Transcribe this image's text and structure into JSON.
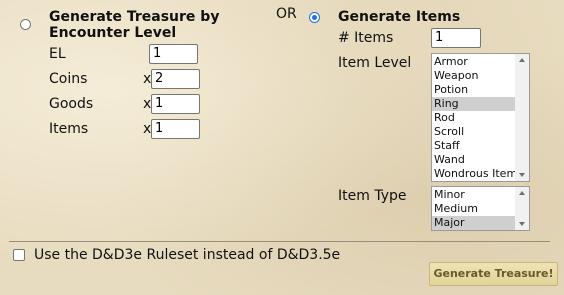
{
  "encounter": {
    "title_line1": "Generate Treasure by",
    "title_line2": "Encounter Level",
    "el_label": "EL",
    "el_value": "1",
    "coins_label": "Coins",
    "coins_mult": "x",
    "coins_value": "2",
    "goods_label": "Goods",
    "goods_mult": "x",
    "goods_value": "1",
    "items_label": "Items",
    "items_mult": "x",
    "items_value": "1",
    "selected": false
  },
  "or_label": "OR",
  "items": {
    "title": "Generate Items",
    "selected": true,
    "count_label": "# Items",
    "count_value": "1",
    "level_label": "Item Level",
    "level_options": [
      "Armor",
      "Weapon",
      "Potion",
      "Ring",
      "Rod",
      "Scroll",
      "Staff",
      "Wand",
      "Wondrous Item"
    ],
    "level_selected": "Ring",
    "type_label": "Item Type",
    "type_options": [
      "Minor",
      "Medium",
      "Major"
    ],
    "type_selected": "Major"
  },
  "ruleset_label": "Use the D&D3e Ruleset instead of D&D3.5e",
  "ruleset_checked": false,
  "generate_button": "Generate Treasure!"
}
